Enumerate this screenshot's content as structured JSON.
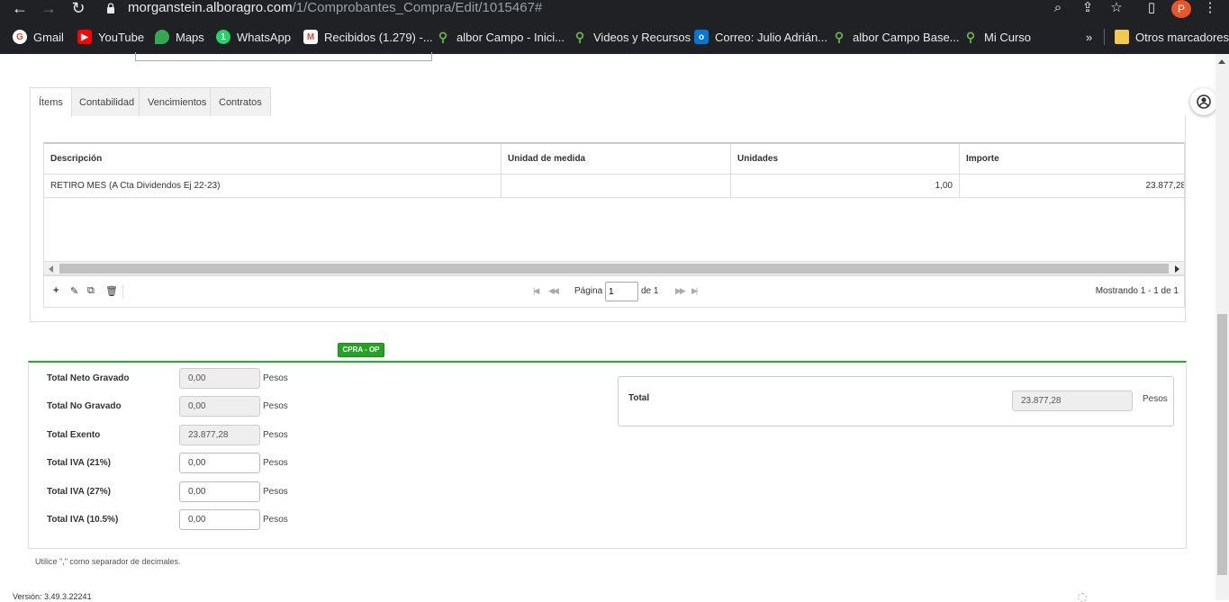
{
  "browser": {
    "url_host": "morganstein.alboragro.com",
    "url_path": "/1/Comprobantes_Compra/Edit/1015467#",
    "profile_initial": "P",
    "bookmarks": [
      {
        "label": "Gmail",
        "icon": "gmail-icon",
        "color": "#ea4335"
      },
      {
        "label": "YouTube",
        "icon": "youtube-icon",
        "color": "#ff0000"
      },
      {
        "label": "Maps",
        "icon": "maps-icon",
        "color": "#34a853"
      },
      {
        "label": "WhatsApp",
        "icon": "whatsapp-icon",
        "color": "#25d366"
      },
      {
        "label": "Recibidos (1.279) -...",
        "icon": "gmail-icon",
        "color": "#ea4335"
      },
      {
        "label": "albor Campo - Inici...",
        "icon": "sprout-icon",
        "color": "#6ab04c"
      },
      {
        "label": "Videos y Recursos",
        "icon": "sprout-icon",
        "color": "#6ab04c"
      },
      {
        "label": "Correo: Julio Adrián...",
        "icon": "outlook-icon",
        "color": "#0078d4"
      },
      {
        "label": "albor Campo Base...",
        "icon": "sprout-icon",
        "color": "#6ab04c"
      },
      {
        "label": "Mi Curso",
        "icon": "sprout-icon",
        "color": "#6ab04c"
      }
    ],
    "more_bookmarks": "»",
    "other_bookmarks": "Otros marcadores"
  },
  "tabs": [
    {
      "label": "Ítems",
      "active": true
    },
    {
      "label": "Contabilidad",
      "active": false
    },
    {
      "label": "Vencimientos",
      "active": false
    },
    {
      "label": "Contratos",
      "active": false
    }
  ],
  "grid": {
    "columns": [
      "Descripción",
      "Unidad de medida",
      "Unidades",
      "Importe"
    ],
    "rows": [
      [
        "RETIRO MES (A Cta Dividendos Ej 22-23)",
        "",
        "1,00",
        "23.877,28"
      ]
    ]
  },
  "pager": {
    "page_label": "Página",
    "page_value": "1",
    "of_label": "de 1",
    "showing": "Mostrando 1 - 1 de 1"
  },
  "badge": "CPRA - OP",
  "totals": {
    "rows": [
      {
        "label": "Total Neto Gravado",
        "value": "0,00",
        "unit": "Pesos",
        "readonly": true
      },
      {
        "label": "Total No Gravado",
        "value": "0,00",
        "unit": "Pesos",
        "readonly": true
      },
      {
        "label": "Total Exento",
        "value": "23.877,28",
        "unit": "Pesos",
        "readonly": true
      },
      {
        "label": "Total IVA (21%)",
        "value": "0,00",
        "unit": "Pesos",
        "readonly": false
      },
      {
        "label": "Total IVA (27%)",
        "value": "0,00",
        "unit": "Pesos",
        "readonly": false
      },
      {
        "label": "Total IVA (10.5%)",
        "value": "0,00",
        "unit": "Pesos",
        "readonly": false
      }
    ],
    "total_label": "Total",
    "total_value": "23.877,28",
    "total_unit": "Pesos"
  },
  "hint": "Utilice \",\" como separador de decimales.",
  "version": "Versión: 3.49.3.22241"
}
